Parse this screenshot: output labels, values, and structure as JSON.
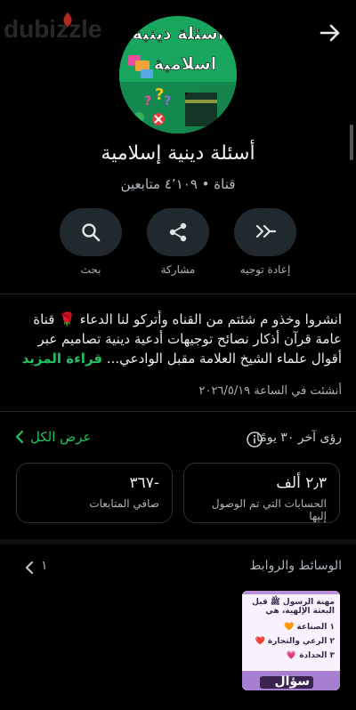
{
  "watermark": "dubizzle",
  "channel": {
    "name": "أسئلة دينية إسلامية",
    "meta": "قناة • ٤٬١٠٩ متابعين",
    "avatar_title_line1": "أسئلة دينية",
    "avatar_title_line2": "اسلامية"
  },
  "actions": [
    {
      "label": "إعادة توجيه",
      "icon": "forward-icon"
    },
    {
      "label": "مشاركة",
      "icon": "share-icon"
    },
    {
      "label": "بحث",
      "icon": "search-icon"
    }
  ],
  "description": {
    "text": "انشروا وخذو م شئتم من القناه وأتركو لنا الدعاء 🌹 قناة عامة قرآن أذكار نصائح توجيهات أدعية دينية تصاميم عبر أقوال علماء الشيخ العلامة مقبل الوادعي... ",
    "more": "قراءة المزيد"
  },
  "created": "أنشئت في الساعة ٢٠٢٦/٥/١٩",
  "insights": {
    "title": "رؤى آخر ٣٠ يومًا",
    "view_all": "عرض الكل",
    "stats": [
      {
        "value": "٢٫٣ ألف",
        "caption": "الحسابات التي تم الوصول إليها"
      },
      {
        "value": "-٣٦٧",
        "caption": "صافي المتابعات"
      }
    ]
  },
  "media": {
    "title": "الوسائط والروابط",
    "count": "١",
    "thumb": {
      "q1": "مهنة الرسول ﷺ قبل",
      "q2": "البعثة الإلهية، هي",
      "opt1": "١ الصناعة 🧡",
      "opt2": "٢ الرعي والتجارة ❤️",
      "opt3": "٣ الحدادة 💗",
      "brand": "سؤال"
    }
  },
  "colors": {
    "accent": "#21c063",
    "background": "#000000",
    "card_border": "#2a3237"
  }
}
